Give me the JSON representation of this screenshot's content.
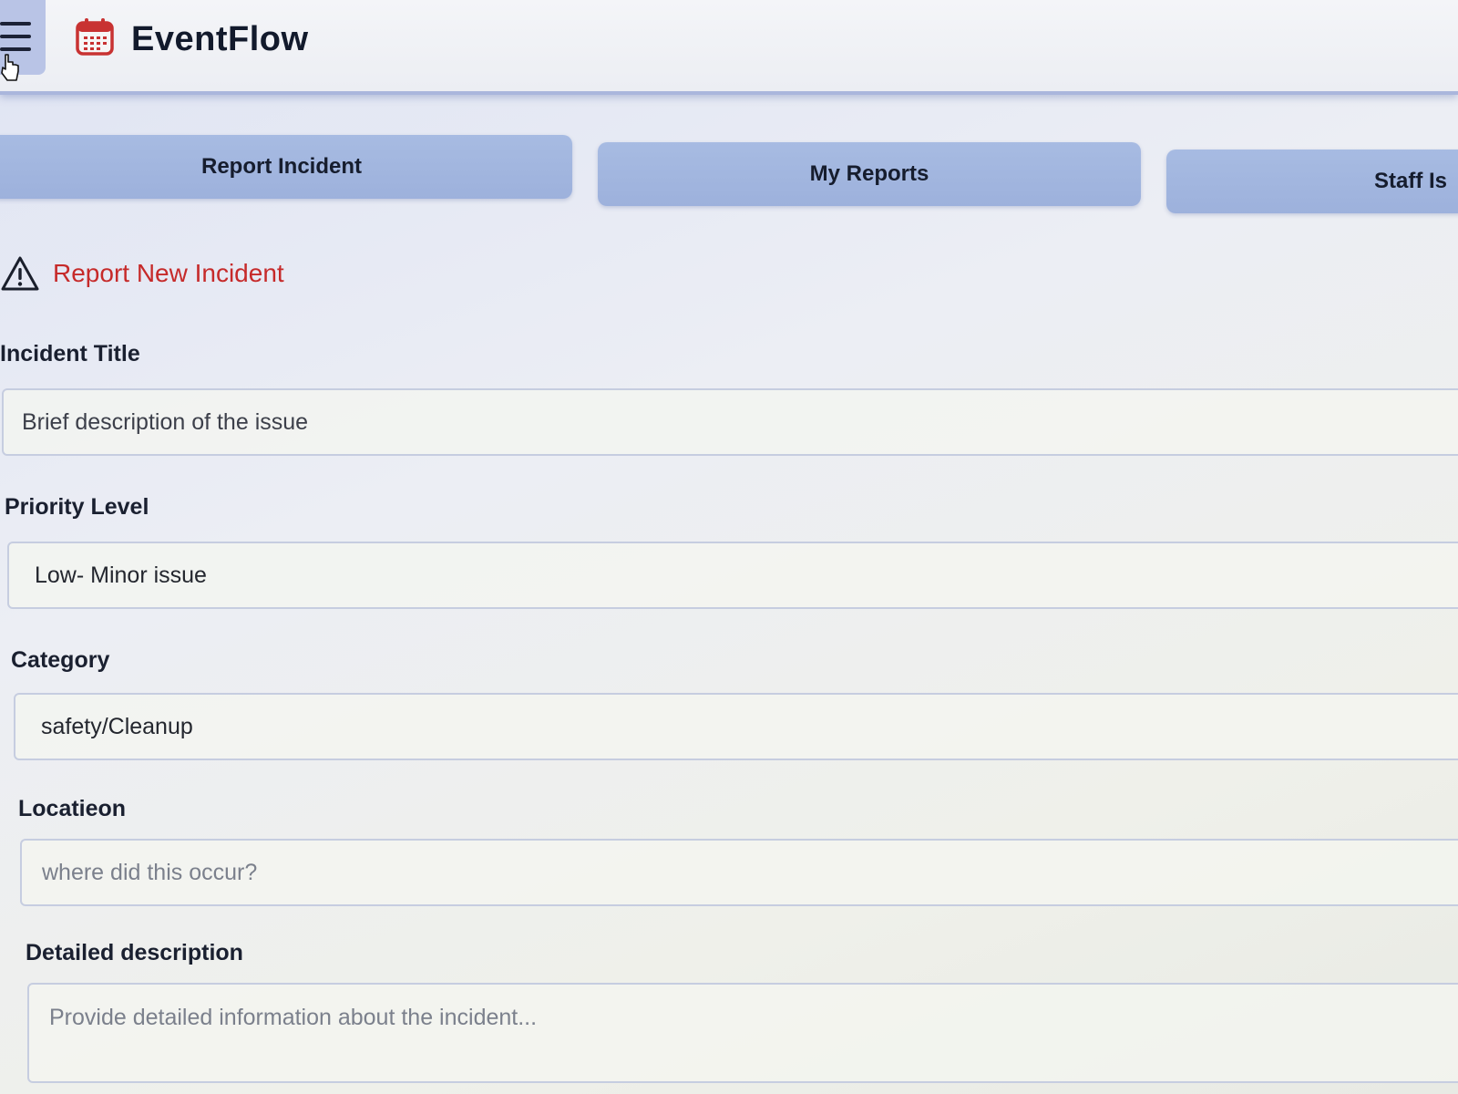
{
  "app": {
    "name": "EventFlow",
    "icon": "calendar-icon",
    "accent_color": "#c62a2a"
  },
  "tabs": [
    {
      "label": "Report Incident"
    },
    {
      "label": "My Reports"
    },
    {
      "label": "Staff Is"
    }
  ],
  "section": {
    "icon": "warning-icon",
    "title": "Report New Incident"
  },
  "form": {
    "title": {
      "label": "Incident Title",
      "value": "Brief description of the issue"
    },
    "priority": {
      "label": "Priority Level",
      "value": "Low- Minor issue"
    },
    "category": {
      "label": "Category",
      "value": "safety/Cleanup"
    },
    "location": {
      "label": "Locatieon",
      "placeholder": "where did this occur?"
    },
    "description": {
      "label": "Detailed description",
      "placeholder": "Provide detailed information about the incident..."
    }
  }
}
